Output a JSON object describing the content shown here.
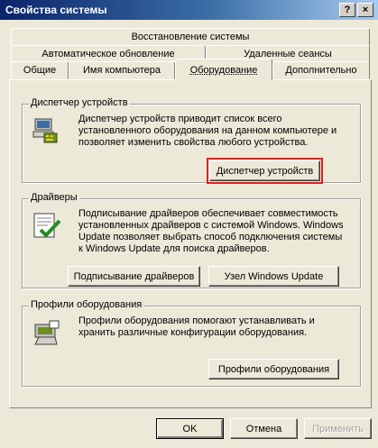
{
  "window": {
    "title": "Свойства системы",
    "help_label": "?",
    "close_label": "×"
  },
  "tabs": {
    "row1": [
      {
        "label": "Восстановление системы"
      }
    ],
    "row2": [
      {
        "label": "Автоматическое обновление"
      },
      {
        "label": "Удаленные сеансы"
      }
    ],
    "row3": [
      {
        "label": "Общие"
      },
      {
        "label": "Имя компьютера"
      },
      {
        "label": "Оборудование"
      },
      {
        "label": "Дополнительно"
      }
    ],
    "active": "Оборудование"
  },
  "groups": {
    "device_manager": {
      "legend": "Диспетчер устройств",
      "description": "Диспетчер устройств приводит список всего установленного оборудования на данном компьютере и позволяет изменить свойства любого устройства.",
      "button_label": "Диспетчер устройств",
      "icon": "device-manager-icon"
    },
    "drivers": {
      "legend": "Драйверы",
      "description": "Подписывание драйверов обеспечивает совместимость установленных драйверов с системой Windows. Windows Update позволяет выбрать способ подключения системы к Windows Update для поиска драйверов.",
      "signing_button_label": "Подписывание драйверов",
      "update_button_label": "Узел Windows Update",
      "icon": "driver-signing-icon"
    },
    "hardware_profiles": {
      "legend": "Профили оборудования",
      "description": "Профили оборудования помогают устанавливать и хранить различные конфигурации оборудования.",
      "button_label": "Профили оборудования",
      "icon": "hardware-profiles-icon"
    }
  },
  "footer": {
    "ok_label": "OK",
    "cancel_label": "Отмена",
    "apply_label": "Применить"
  },
  "colors": {
    "highlight": "#e02020",
    "window_bg": "#ece9d8",
    "title_start": "#0a246a"
  }
}
